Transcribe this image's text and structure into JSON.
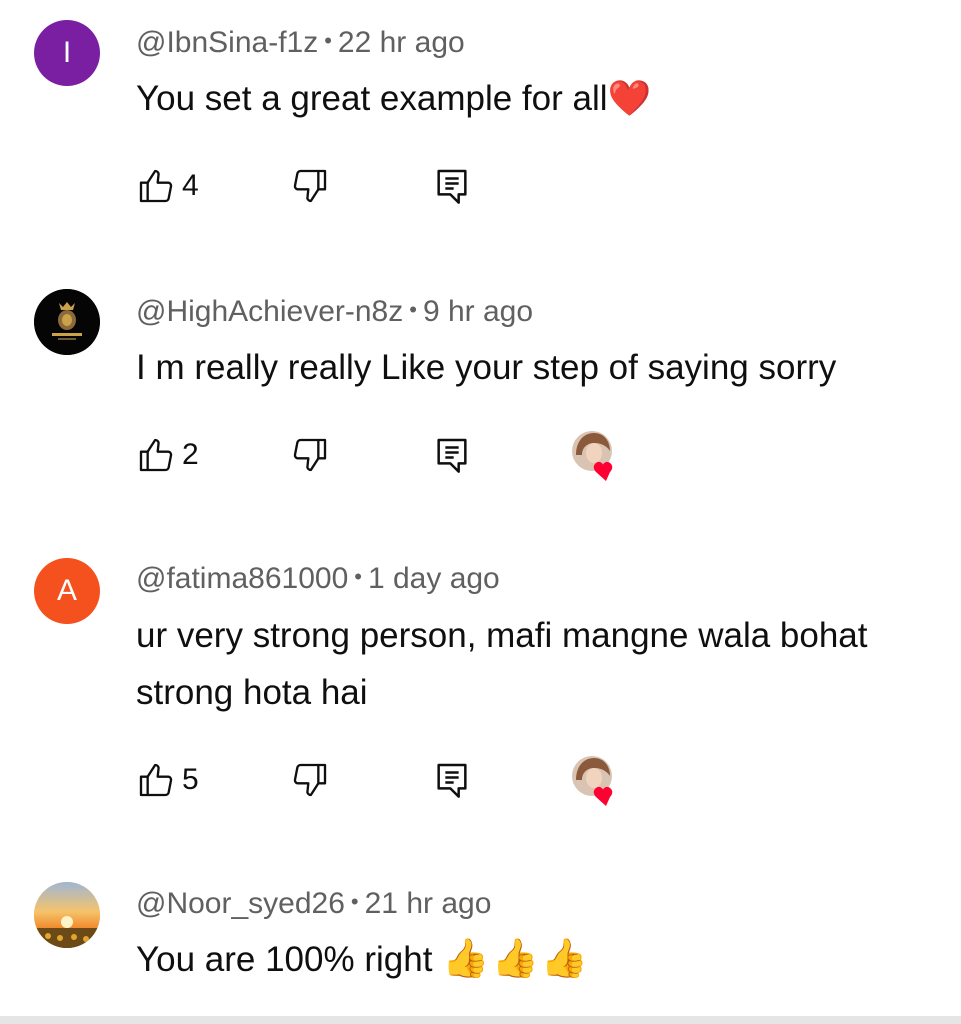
{
  "comments": [
    {
      "author": "@IbnSina-f1z",
      "time": "22 hr ago",
      "text": "You set a great example for all",
      "emoji": "❤️",
      "likes": "4",
      "avatar_letter": "I",
      "avatar_color": "#7b1fa2",
      "creator_heart": false
    },
    {
      "author": "@HighAchiever-n8z",
      "time": "9 hr ago",
      "text": "I m really really Like your step of saying sorry",
      "likes": "2",
      "avatar_color": "#000000",
      "creator_heart": true
    },
    {
      "author": "@fatima861000",
      "time": "1 day ago",
      "text": "ur very strong person, mafi mangne wala bohat strong hota hai",
      "likes": "5",
      "avatar_letter": "A",
      "avatar_color": "#f4511e",
      "creator_heart": true
    },
    {
      "author": "@Noor_syed26",
      "time": "21 hr ago",
      "text": "You are 100% right",
      "emoji": "👍👍👍",
      "avatar_color": "#f2b44a"
    }
  ],
  "colors": {
    "meta_text": "#606060",
    "heart": "#ff0033"
  },
  "icons": [
    "thumbs-up-icon",
    "thumbs-down-icon",
    "reply-icon",
    "creator-heart-icon"
  ]
}
